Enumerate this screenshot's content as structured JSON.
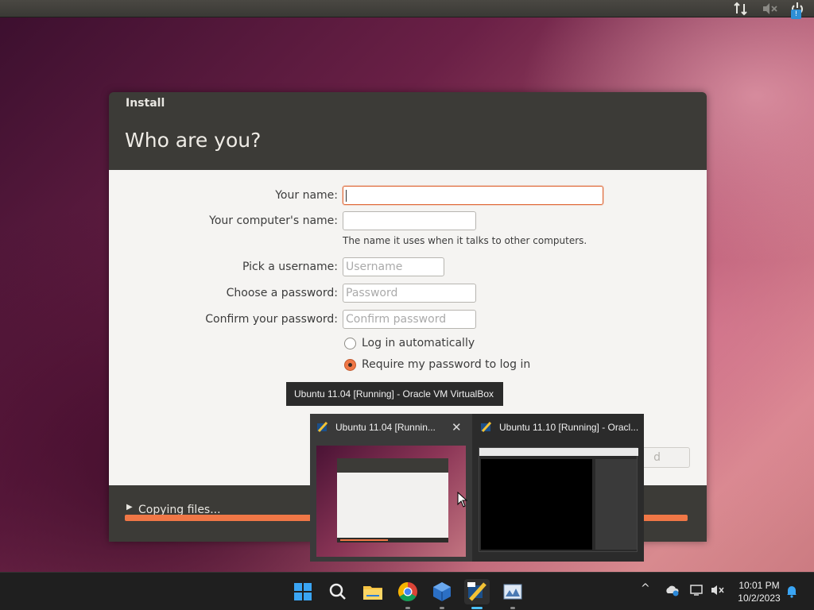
{
  "top_panel": {
    "icons": [
      "network-arrows-icon",
      "volume-muted-icon",
      "power-icon"
    ],
    "power_badge": "!"
  },
  "installer": {
    "window_title": "Install",
    "heading": "Who are you?",
    "form": {
      "your_name_label": "Your name:",
      "your_name_value": "",
      "computer_name_label": "Your computer's name:",
      "computer_name_value": "",
      "computer_name_hint": "The name it uses when it talks to other computers.",
      "username_label": "Pick a username:",
      "username_placeholder": "Username",
      "password_label": "Choose a password:",
      "password_placeholder": "Password",
      "confirm_label": "Confirm your password:",
      "confirm_placeholder": "Confirm password",
      "login_auto_label": "Log in automatically",
      "login_auto_selected": false,
      "require_password_label": "Require my password to log in",
      "require_password_selected": true,
      "forward_button_partial": "d"
    },
    "footer": {
      "status": "Copying files...",
      "progress_fraction": 1.0
    }
  },
  "tooltip": {
    "text": "Ubuntu 11.04 [Running] - Oracle VM VirtualBox"
  },
  "thumbnails": [
    {
      "title": "Ubuntu 11.04 [Runnin...",
      "close": "✕",
      "active": true
    },
    {
      "title": "Ubuntu 11.10 [Running] - Oracl...",
      "active": false
    }
  ],
  "taskbar": {
    "apps": [
      "windows-start-icon",
      "search-icon",
      "file-explorer-icon",
      "chrome-icon",
      "virtualbox-3d-icon",
      "virtualbox-vm-icon",
      "photo-app-icon"
    ],
    "tray": {
      "chevron": "^"
    },
    "clock_time": "10:01 PM",
    "clock_date": "10/2/2023"
  },
  "colors": {
    "accent_orange": "#f07746",
    "installer_dark": "#3c3b37",
    "taskbar_bg": "#1f1f1f",
    "taskbar_active": "#4cc2ff"
  }
}
